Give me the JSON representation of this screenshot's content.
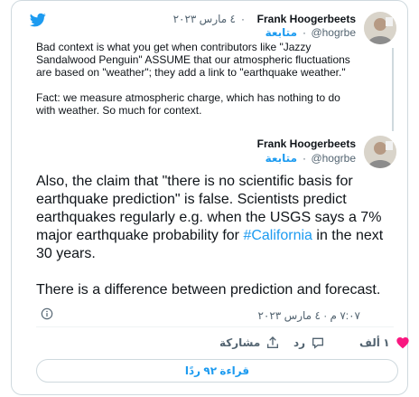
{
  "colors": {
    "accent": "#1d9bf0",
    "like": "#f91880",
    "text": "#0f1419",
    "muted": "#536471",
    "border": "#cfd9de"
  },
  "icons": {
    "logo": "twitter-bird-icon",
    "info": "info-icon",
    "like": "heart-icon",
    "reply": "reply-icon",
    "share": "share-icon"
  },
  "quoted_tweet": {
    "author_name": "Frank Hoogerbeets",
    "handle": "@hogrbe",
    "date": "٤ مارس ٢٠٢٣",
    "follow_label": "متابعة",
    "paragraphs": [
      "Bad context is what you get when contributors like \"Jazzy Sandalwood Penguin\" ASSUME that our atmospheric fluctuations are based on \"weather\"; they add a link to \"earthquake weather.\"",
      "Fact: we measure atmospheric charge, which has nothing to do with weather. So much for context."
    ]
  },
  "main_tweet": {
    "author_name": "Frank Hoogerbeets",
    "handle": "@hogrbe",
    "follow_label": "متابعة",
    "text_before_hashtag": "Also, the claim that \"there is no scientific basis for earthquake prediction\" is false. Scientists predict earthquakes regularly e.g. when the USGS says a 7% major earthquake probability for ",
    "hashtag": "#California",
    "text_after_hashtag": " in the next 30 years.",
    "paragraph_2": "There is a difference between prediction and forecast.",
    "timestamp": "٧:٠٧ م · ٤ مارس ٢٠٢٣"
  },
  "actions": {
    "like_count": "١ ألف",
    "reply_label": "رد",
    "share_label": "مشاركة"
  },
  "read_replies_label": "قراءة ٩٢ ردًا"
}
